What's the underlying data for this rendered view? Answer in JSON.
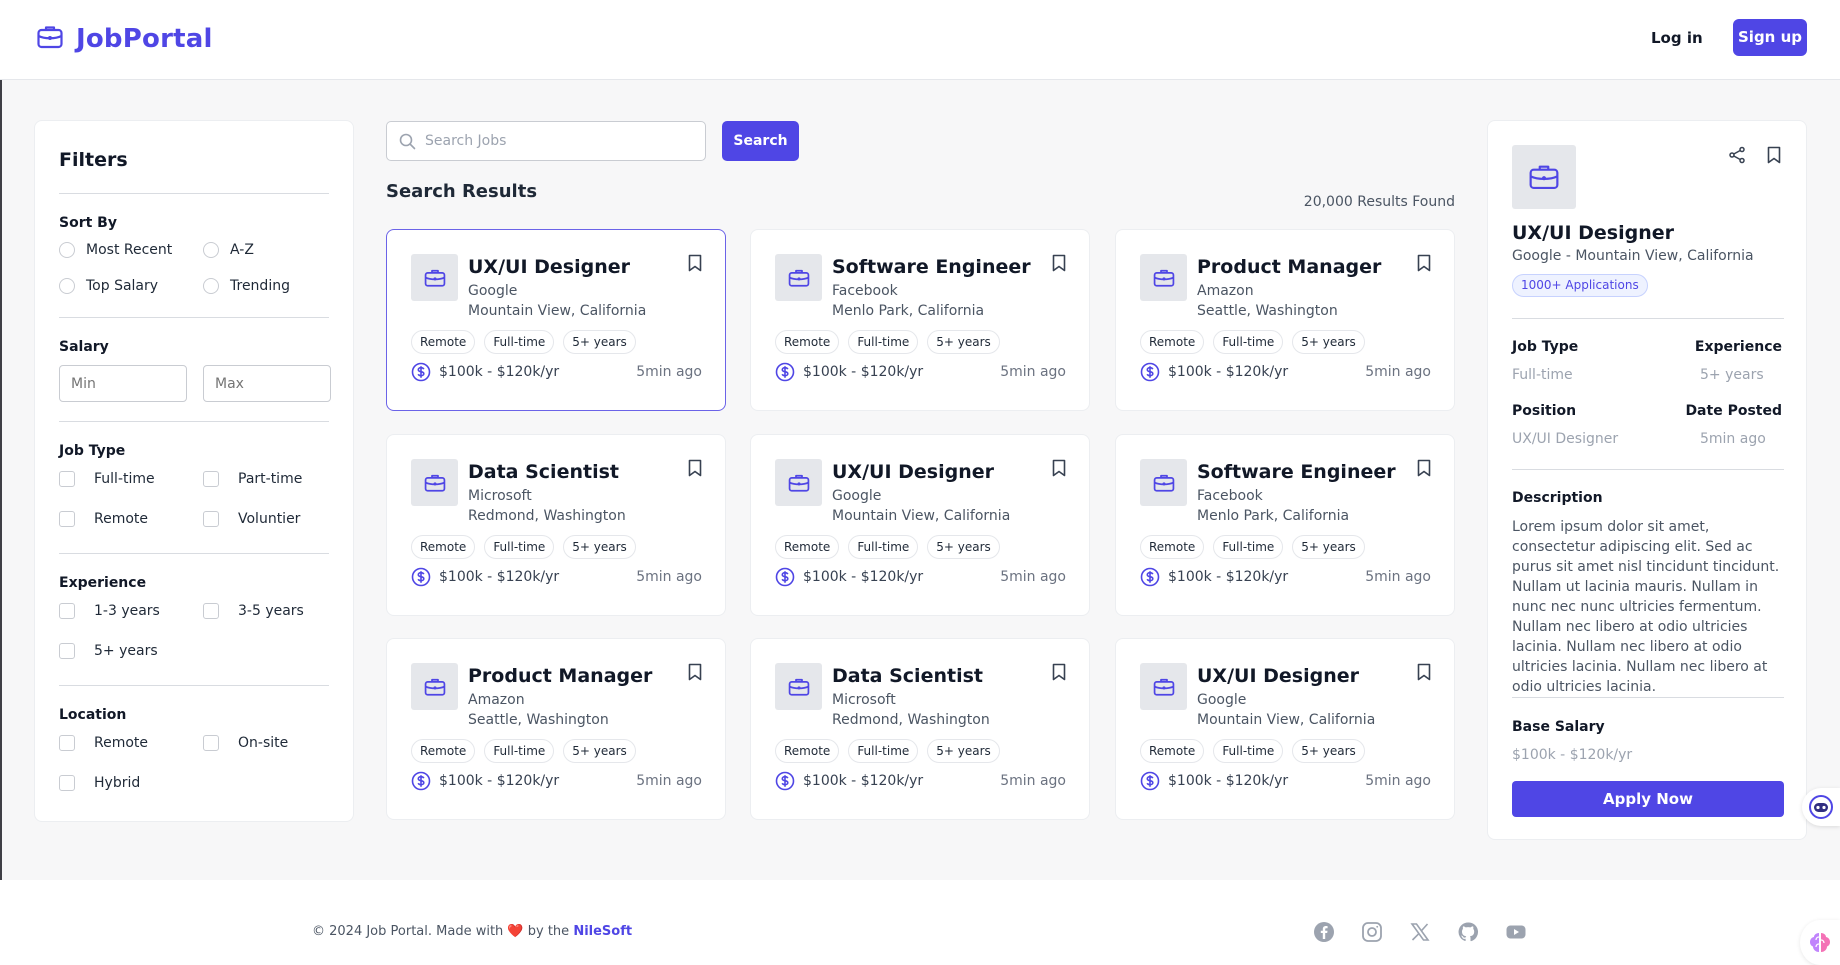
{
  "brand": {
    "name": "JobPortal",
    "accent": "#4f46e5"
  },
  "header": {
    "login": "Log in",
    "signup": "Sign up"
  },
  "filters": {
    "title": "Filters",
    "sort": {
      "title": "Sort By",
      "options": [
        "Most Recent",
        "A-Z",
        "Top Salary",
        "Trending"
      ]
    },
    "salary": {
      "title": "Salary",
      "min_placeholder": "Min",
      "max_placeholder": "Max"
    },
    "job_type": {
      "title": "Job Type",
      "options": [
        "Full-time",
        "Part-time",
        "Remote",
        "Voluntier"
      ]
    },
    "experience": {
      "title": "Experience",
      "options": [
        "1-3 years",
        "3-5 years",
        "5+ years"
      ]
    },
    "location": {
      "title": "Location",
      "options": [
        "Remote",
        "On-site",
        "Hybrid"
      ]
    }
  },
  "search": {
    "placeholder": "Search Jobs",
    "button": "Search",
    "icon": "search-icon"
  },
  "results": {
    "title": "Search Results",
    "count": "20,000 Results Found",
    "jobs": [
      {
        "title": "UX/UI Designer",
        "company": "Google",
        "location": "Mountain View, California",
        "tags": [
          "Remote",
          "Full-time",
          "5+ years"
        ],
        "salary": "$100k - $120k/yr",
        "posted": "5min ago",
        "selected": true
      },
      {
        "title": "Software Engineer",
        "company": "Facebook",
        "location": "Menlo Park, California",
        "tags": [
          "Remote",
          "Full-time",
          "5+ years"
        ],
        "salary": "$100k - $120k/yr",
        "posted": "5min ago"
      },
      {
        "title": "Product Manager",
        "company": "Amazon",
        "location": "Seattle, Washington",
        "tags": [
          "Remote",
          "Full-time",
          "5+ years"
        ],
        "salary": "$100k - $120k/yr",
        "posted": "5min ago"
      },
      {
        "title": "Data Scientist",
        "company": "Microsoft",
        "location": "Redmond, Washington",
        "tags": [
          "Remote",
          "Full-time",
          "5+ years"
        ],
        "salary": "$100k - $120k/yr",
        "posted": "5min ago"
      },
      {
        "title": "UX/UI Designer",
        "company": "Google",
        "location": "Mountain View, California",
        "tags": [
          "Remote",
          "Full-time",
          "5+ years"
        ],
        "salary": "$100k - $120k/yr",
        "posted": "5min ago"
      },
      {
        "title": "Software Engineer",
        "company": "Facebook",
        "location": "Menlo Park, California",
        "tags": [
          "Remote",
          "Full-time",
          "5+ years"
        ],
        "salary": "$100k - $120k/yr",
        "posted": "5min ago"
      },
      {
        "title": "Product Manager",
        "company": "Amazon",
        "location": "Seattle, Washington",
        "tags": [
          "Remote",
          "Full-time",
          "5+ years"
        ],
        "salary": "$100k - $120k/yr",
        "posted": "5min ago"
      },
      {
        "title": "Data Scientist",
        "company": "Microsoft",
        "location": "Redmond, Washington",
        "tags": [
          "Remote",
          "Full-time",
          "5+ years"
        ],
        "salary": "$100k - $120k/yr",
        "posted": "5min ago"
      },
      {
        "title": "UX/UI Designer",
        "company": "Google",
        "location": "Mountain View, California",
        "tags": [
          "Remote",
          "Full-time",
          "5+ years"
        ],
        "salary": "$100k - $120k/yr",
        "posted": "5min ago"
      }
    ]
  },
  "detail": {
    "title": "UX/UI Designer",
    "subtitle": "Google - Mountain View, California",
    "badge": "1000+ Applications",
    "job_type_label": "Job Type",
    "job_type": "Full-time",
    "experience_label": "Experience",
    "experience": "5+ years",
    "position_label": "Position",
    "position": "UX/UI Designer",
    "date_label": "Date Posted",
    "date": "5min ago",
    "description_label": "Description",
    "description": "Lorem ipsum dolor sit amet, consectetur adipiscing elit. Sed ac purus sit amet nisl tincidunt tincidunt. Nullam ut lacinia mauris. Nullam in nunc nec nunc ultricies fermentum. Nullam nec libero at odio ultricies lacinia. Nullam nec libero at odio ultricies lacinia. Nullam nec libero at odio ultricies lacinia.",
    "salary_label": "Base Salary",
    "salary": "$100k - $120k/yr",
    "apply": "Apply Now"
  },
  "footer": {
    "copyright_prefix": "© 2024 Job Portal. Made with",
    "heart": "❤️",
    "by": "by the",
    "maker": "NileSoft",
    "socials": [
      "facebook-icon",
      "instagram-icon",
      "x-icon",
      "github-icon",
      "youtube-icon"
    ]
  }
}
